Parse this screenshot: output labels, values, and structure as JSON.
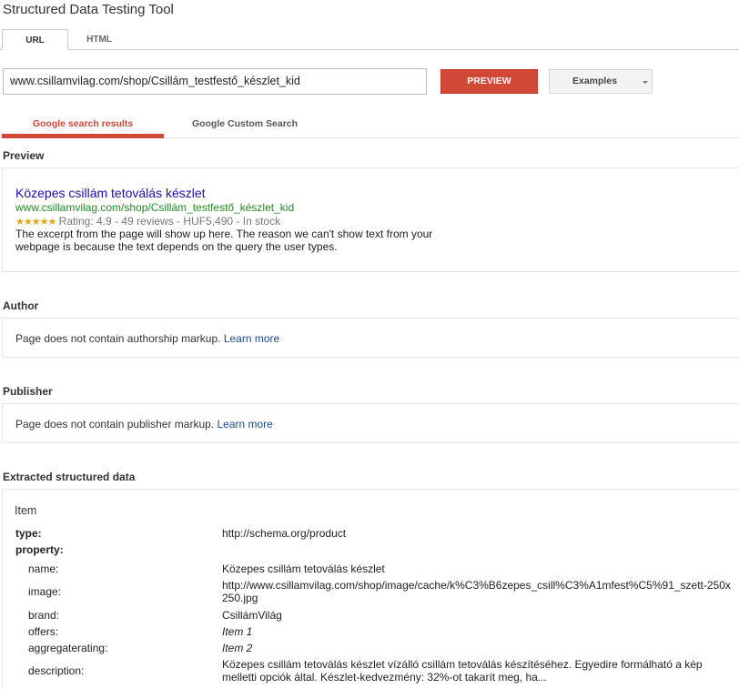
{
  "header": {
    "title": "Structured Data Testing Tool"
  },
  "input_tabs": [
    {
      "label": "URL",
      "active": true
    },
    {
      "label": "HTML",
      "active": false
    }
  ],
  "url_field": {
    "value": "www.csillamvilag.com/shop/Csillám_testfestő_készlet_kid"
  },
  "buttons": {
    "preview_label": "PREVIEW",
    "examples_label": "Examples"
  },
  "result_tabs": [
    {
      "label": "Google search results",
      "active": true
    },
    {
      "label": "Google Custom Search",
      "active": false
    }
  ],
  "preview": {
    "section_title": "Preview",
    "result_title": "Közepes csillám tetoválás készlet",
    "result_url": "www.csillamvilag.com/shop/Csillám_testfestő_készlet_kid",
    "stars": "★★★★★",
    "rating_text": "Rating: 4.9 - 49 reviews - HUF5,490 - In stock",
    "snippet": "The excerpt from the page will show up here. The reason we can't show text from your webpage is because the text depends on the query the user types."
  },
  "author": {
    "section_title": "Author",
    "message": "Page does not contain authorship markup.",
    "link": "Learn more"
  },
  "publisher": {
    "section_title": "Publisher",
    "message": "Page does not contain publisher markup.",
    "link": "Learn more"
  },
  "extracted": {
    "section_title": "Extracted structured data",
    "item_title": "Item",
    "type_key": "type:",
    "type_value": "http://schema.org/product",
    "property_key": "property:",
    "properties": [
      {
        "key": "name:",
        "value": "Közepes csillám tetoválás készlet"
      },
      {
        "key": "image:",
        "value": "http://www.csillamvilag.com/shop/image/cache/k%C3%B6zepes_csill%C3%A1mfest%C5%91_szett-250x250.jpg"
      },
      {
        "key": "brand:",
        "value": "CsillámVilág"
      },
      {
        "key": "offers:",
        "value": "Item 1"
      },
      {
        "key": "aggregaterating:",
        "value": "Item 2"
      },
      {
        "key": "description:",
        "value": "Közepes csillám tetoválás készlet vízálló csillám tetoválás készítéséhez. Egyedire formálható a kép melletti opciók által. Készlet-kedvezmény: 32%-ot takarít meg, ha..."
      }
    ]
  }
}
